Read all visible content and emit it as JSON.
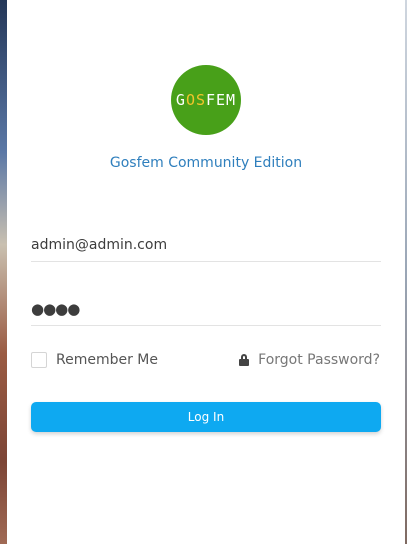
{
  "brand": {
    "logo_text": [
      "G",
      "OS",
      "FEM"
    ],
    "edition_title": "Gosfem Community Edition"
  },
  "login": {
    "email_value": "admin@admin.com",
    "password_mask": "●●●●",
    "remember_label": "Remember Me",
    "forgot_label": "Forgot Password?",
    "submit_label": "Log In"
  },
  "icons": {
    "forgot": "lock-icon",
    "logo": "gosfem-logo"
  },
  "colors": {
    "logo_bg": "#48a019",
    "accent": "#2f7fbd",
    "button": "#0ea9f1"
  }
}
